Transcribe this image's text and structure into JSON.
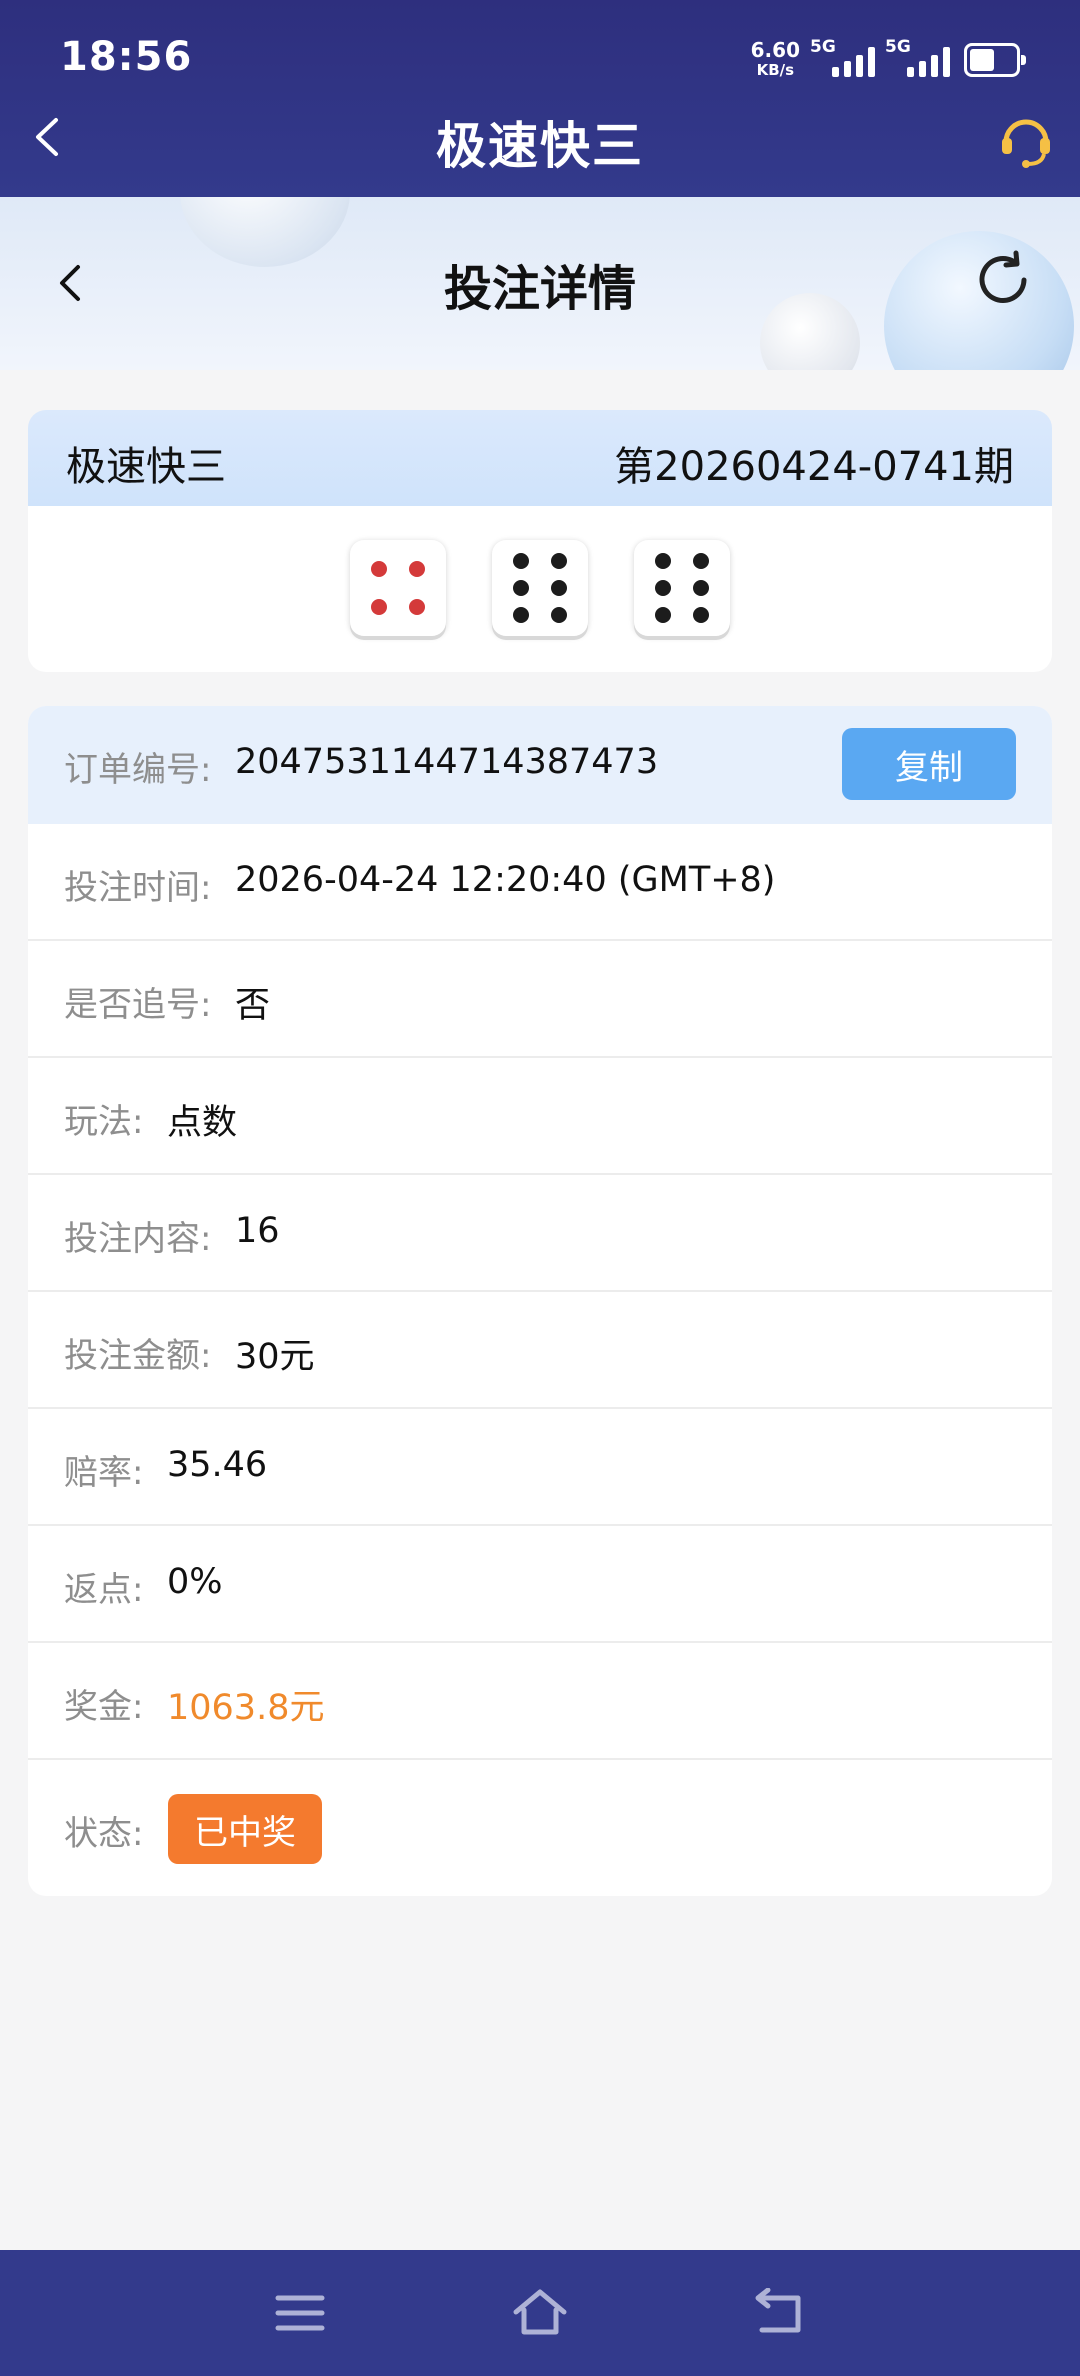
{
  "status_bar": {
    "time": "18:56",
    "net_speed_value": "6.60",
    "net_speed_unit": "KB/s",
    "sim1_label": "5G",
    "sim2_label": "5G",
    "battery_level": 0.6
  },
  "app_bar": {
    "title": "极速快三",
    "back_icon": "chevron-left-icon",
    "support_icon": "headset-icon"
  },
  "banner": {
    "title": "投注详情",
    "back_icon": "chevron-left-icon",
    "refresh_icon": "refresh-icon"
  },
  "result": {
    "lottery_name": "极速快三",
    "issue": "第20260424-0741期",
    "dice": [
      4,
      6,
      6
    ]
  },
  "details": {
    "order_no_label": "订单编号:",
    "order_no_value": "2047531144714387473",
    "copy_label": "复制",
    "bet_time_label": "投注时间:",
    "bet_time_value": "2026-04-24 12:20:40 (GMT+8)",
    "chase_label": "是否追号:",
    "chase_value": "否",
    "play_label": "玩法:",
    "play_value": "点数",
    "content_label": "投注内容:",
    "content_value": "16",
    "amount_label": "投注金额:",
    "amount_value": "30元",
    "odds_label": "赔率:",
    "odds_value": "35.46",
    "rebate_label": "返点:",
    "rebate_value": "0%",
    "prize_label": "奖金:",
    "prize_value": "1063.8元",
    "status_label": "状态:",
    "status_value": "已中奖"
  },
  "colors": {
    "header_bg": "#2e2f7e",
    "nav_bg": "#333a8c",
    "copy_button": "#5aa8f2",
    "status_badge": "#f47a2e",
    "prize_text": "#f08a2c",
    "pip_red": "#d43a3a",
    "pip_black": "#1c1c1c"
  },
  "nav_bar": {
    "menu_icon": "menu-icon",
    "home_icon": "home-icon",
    "back_icon": "return-icon"
  }
}
